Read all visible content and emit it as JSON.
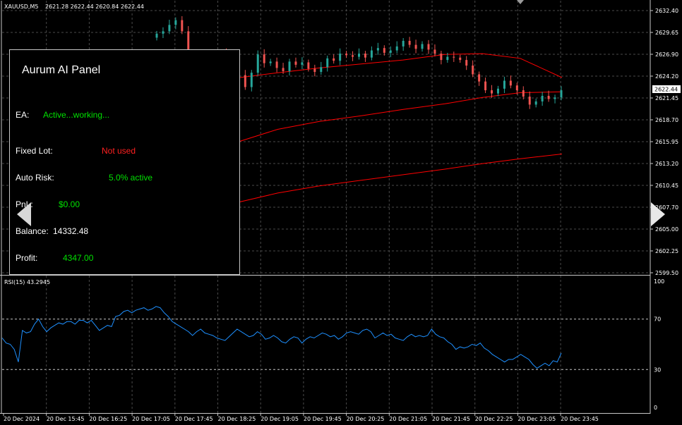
{
  "header": {
    "symbol": "XAUUSD,M5",
    "quote": "2621.28 2622.44 2620.84 2622.44"
  },
  "price_axis": {
    "labels": [
      "2632.40",
      "2629.65",
      "2626.90",
      "2624.20",
      "2621.45",
      "2618.70",
      "2615.95",
      "2613.20",
      "2610.45",
      "2607.70",
      "2605.00",
      "2602.25",
      "2599.50"
    ],
    "current_price": "2622.44"
  },
  "rsi": {
    "label": "RSI(15) 43.2945",
    "levels": [
      "100",
      "70",
      "30",
      "0"
    ]
  },
  "time_axis": {
    "labels": [
      "20 Dec 2024",
      "20 Dec 15:45",
      "20 Dec 16:25",
      "20 Dec 17:05",
      "20 Dec 17:45",
      "20 Dec 18:25",
      "20 Dec 19:05",
      "20 Dec 19:45",
      "20 Dec 20:25",
      "20 Dec 21:05",
      "20 Dec 21:45",
      "20 Dec 22:25",
      "20 Dec 23:05",
      "20 Dec 23:45"
    ]
  },
  "panel": {
    "title": "Aurum AI Panel",
    "ea_label": "EA:",
    "ea_value": "Active...working...",
    "lot_label": "Fixed Lot:",
    "lot_value": "Not used",
    "risk_label": "Auto Risk:",
    "risk_value": "5.0% active",
    "pnl_label": "PnL:",
    "pnl_value": "$0.00",
    "balance_label": "Balance:",
    "balance_value": "14332.48",
    "profit_label": "Profit:",
    "profit_value": "4347.00"
  },
  "colors": {
    "background": "#000000",
    "grid": "#4a4a4a",
    "bull": "#26a69a",
    "bear": "#ef5350",
    "ma": "#ff0000",
    "rsi_line": "#1e90ff"
  },
  "chart_data": [
    {
      "type": "candlestick",
      "y_range": [
        2599.5,
        2632.9
      ],
      "moving_averages": [
        {
          "x_index": [
            1,
            10,
            20,
            30,
            40,
            50,
            59,
            68,
            78
          ],
          "values": [
            2624.0,
            2624.6,
            2625.2,
            2625.7,
            2626.2,
            2626.9,
            2627.0,
            2626.4,
            2624.0
          ]
        },
        {
          "x_index": [
            1,
            10,
            20,
            30,
            40,
            50,
            59,
            68,
            78
          ],
          "values": [
            2616.0,
            2617.5,
            2618.5,
            2619.2,
            2620.0,
            2620.7,
            2621.5,
            2622.1,
            2622.2
          ]
        },
        {
          "x_index": [
            1,
            10,
            20,
            30,
            40,
            50,
            59,
            68,
            78
          ],
          "values": [
            2608.4,
            2609.5,
            2610.4,
            2611.1,
            2611.8,
            2612.5,
            2613.2,
            2613.8,
            2614.4
          ]
        }
      ],
      "candles_close": [
        2629.5,
        2629.8,
        2630.6,
        2631.2,
        2629.8,
        2626.8,
        2624.6,
        2625.8,
        2626.1,
        2626.6,
        2627.0,
        2626.7,
        2626.0,
        2624.3,
        2622.8,
        2624.6,
        2626.9,
        2625.8,
        2626.0,
        2625.2,
        2624.8,
        2626.0,
        2625.6,
        2625.9,
        2625.1,
        2624.7,
        2625.3,
        2626.4,
        2626.1,
        2627.0,
        2626.8,
        2626.6,
        2627.0,
        2626.5,
        2627.4,
        2627.7,
        2627.1,
        2627.4,
        2627.9,
        2628.6,
        2628.1,
        2627.6,
        2628.2,
        2627.5,
        2627.0,
        2626.2,
        2626.6,
        2626.5,
        2626.2,
        2625.5,
        2624.4,
        2623.5,
        2622.4,
        2622.0,
        2622.6,
        2623.6,
        2623.0,
        2622.4,
        2621.6,
        2620.6,
        2621.0,
        2621.7,
        2621.3,
        2621.5,
        2622.4
      ],
      "candles_open": [
        2629.0,
        2629.5,
        2629.8,
        2630.6,
        2631.2,
        2629.8,
        2626.8,
        2624.6,
        2625.8,
        2626.1,
        2626.6,
        2627.0,
        2626.7,
        2626.0,
        2624.3,
        2622.8,
        2624.6,
        2626.9,
        2625.8,
        2626.0,
        2625.2,
        2624.8,
        2626.0,
        2625.6,
        2625.9,
        2625.1,
        2624.7,
        2625.3,
        2626.4,
        2626.1,
        2627.0,
        2626.8,
        2626.6,
        2627.0,
        2626.5,
        2627.4,
        2627.7,
        2627.1,
        2627.4,
        2627.9,
        2628.6,
        2628.1,
        2627.6,
        2628.2,
        2627.5,
        2627.0,
        2626.2,
        2626.6,
        2626.5,
        2626.2,
        2625.5,
        2624.4,
        2623.5,
        2622.4,
        2622.0,
        2622.6,
        2623.6,
        2623.0,
        2622.4,
        2621.6,
        2620.6,
        2621.0,
        2621.7,
        2621.3,
        2621.5
      ]
    },
    {
      "type": "line",
      "name": "RSI(15)",
      "y_range": [
        0,
        100
      ],
      "levels": [
        70,
        30
      ],
      "values": [
        55,
        51,
        50,
        46,
        36,
        61,
        59,
        60,
        66,
        70,
        64,
        60,
        63,
        65,
        67,
        66,
        68,
        68,
        66,
        69,
        69,
        67,
        69,
        65,
        61,
        63,
        65,
        64,
        72,
        73,
        76,
        77,
        75,
        77,
        78,
        79,
        77,
        78,
        80,
        79,
        75,
        72,
        68,
        66,
        64,
        62,
        60,
        57,
        60,
        62,
        59,
        58,
        57,
        55,
        54,
        53,
        56,
        59,
        62,
        60,
        58,
        56,
        57,
        60,
        58,
        54,
        55,
        57,
        55,
        52,
        51,
        54,
        56,
        55,
        51,
        54,
        56,
        55,
        57,
        59,
        58,
        56,
        57,
        54,
        56,
        59,
        60,
        59,
        58,
        61,
        62,
        60,
        55,
        57,
        59,
        57,
        58,
        55,
        54,
        53,
        56,
        58,
        56,
        57,
        56,
        57,
        62,
        58,
        56,
        55,
        52,
        50,
        46,
        48,
        47,
        48,
        50,
        49,
        51,
        47,
        45,
        42,
        40,
        38,
        36,
        38,
        38,
        40,
        42,
        40,
        38,
        34,
        31,
        33,
        35,
        33,
        37,
        36,
        43
      ]
    }
  ]
}
